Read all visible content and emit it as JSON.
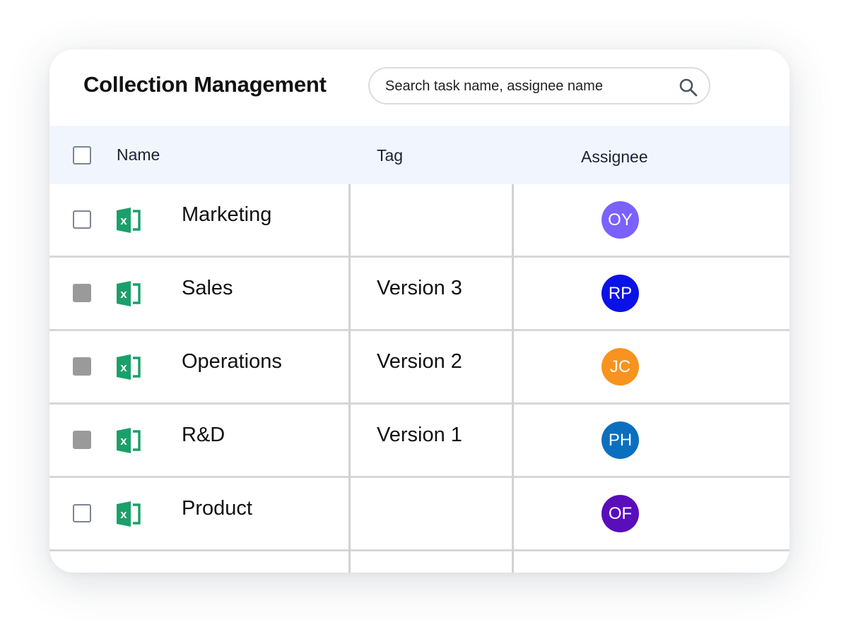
{
  "app": {
    "title": "Collection Management"
  },
  "search": {
    "placeholder": "Search task name, assignee name"
  },
  "table": {
    "columns": {
      "name": "Name",
      "tag": "Tag",
      "assignee": "Assignee"
    },
    "rows": [
      {
        "name": "Marketing",
        "tag": "",
        "assignee": "OY",
        "avatar_color": "#7b61ff",
        "checked": false,
        "file_icon": "excel-icon"
      },
      {
        "name": "Sales",
        "tag": "Version 3",
        "assignee": "RP",
        "avatar_color": "#0a12e8",
        "checked": true,
        "file_icon": "excel-icon"
      },
      {
        "name": "Operations",
        "tag": "Version 2",
        "assignee": "JC",
        "avatar_color": "#f7931e",
        "checked": true,
        "file_icon": "excel-icon"
      },
      {
        "name": "R&D",
        "tag": "Version 1",
        "assignee": "PH",
        "avatar_color": "#0b6fc0",
        "checked": true,
        "file_icon": "excel-icon"
      },
      {
        "name": "Product",
        "tag": "",
        "assignee": "OF",
        "avatar_color": "#5a0dbb",
        "checked": false,
        "file_icon": "excel-icon"
      }
    ]
  },
  "colors": {
    "excel_green": "#1aa06a",
    "header_bg": "#f1f6fe",
    "checked_fill": "#9a9a9a"
  }
}
